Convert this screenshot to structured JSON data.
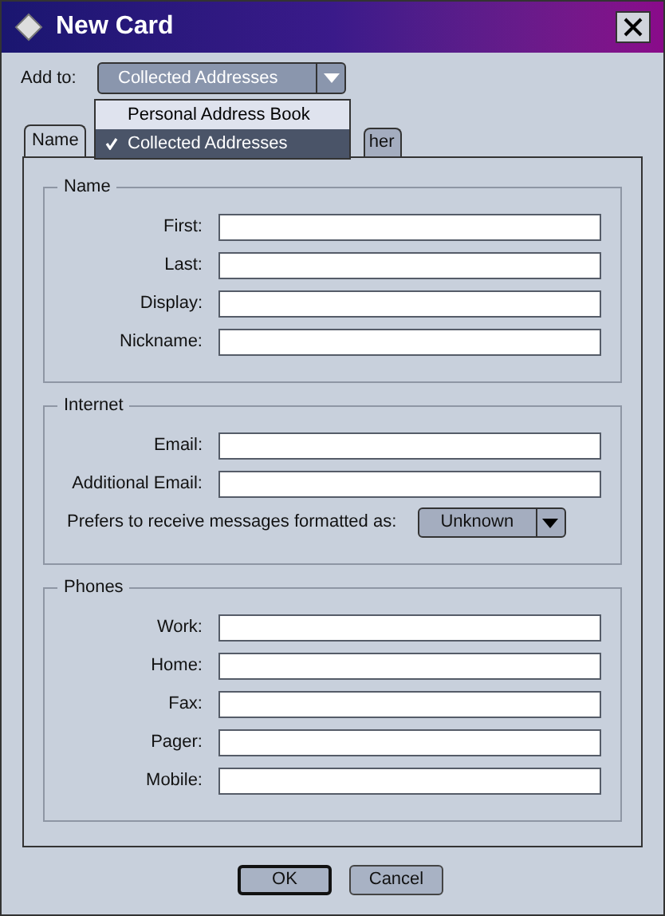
{
  "window": {
    "title": "New Card"
  },
  "add_to": {
    "label": "Add to:",
    "value": "Collected Addresses"
  },
  "add_to_menu": [
    {
      "label": "Personal Address Book",
      "selected": false
    },
    {
      "label": "Collected Addresses",
      "selected": true
    }
  ],
  "tabs": [
    {
      "label": "Name",
      "selected": true
    },
    {
      "label": "her",
      "selected": false
    }
  ],
  "groups": [
    {
      "title": "Name",
      "fields": [
        {
          "label": "First:"
        },
        {
          "label": "Last:"
        },
        {
          "label": "Display:"
        },
        {
          "label": "Nickname:"
        }
      ]
    },
    {
      "title": "Internet",
      "fields": [
        {
          "label": "Email:"
        },
        {
          "label": "Additional Email:"
        }
      ],
      "format": {
        "label": "Prefers to receive messages formatted as:",
        "value": "Unknown"
      }
    },
    {
      "title": "Phones",
      "fields": [
        {
          "label": "Work:"
        },
        {
          "label": "Home:"
        },
        {
          "label": "Fax:"
        },
        {
          "label": "Pager:"
        },
        {
          "label": "Mobile:"
        }
      ]
    }
  ],
  "buttons": [
    {
      "label": "OK",
      "default": true
    },
    {
      "label": "Cancel",
      "default": false
    }
  ]
}
